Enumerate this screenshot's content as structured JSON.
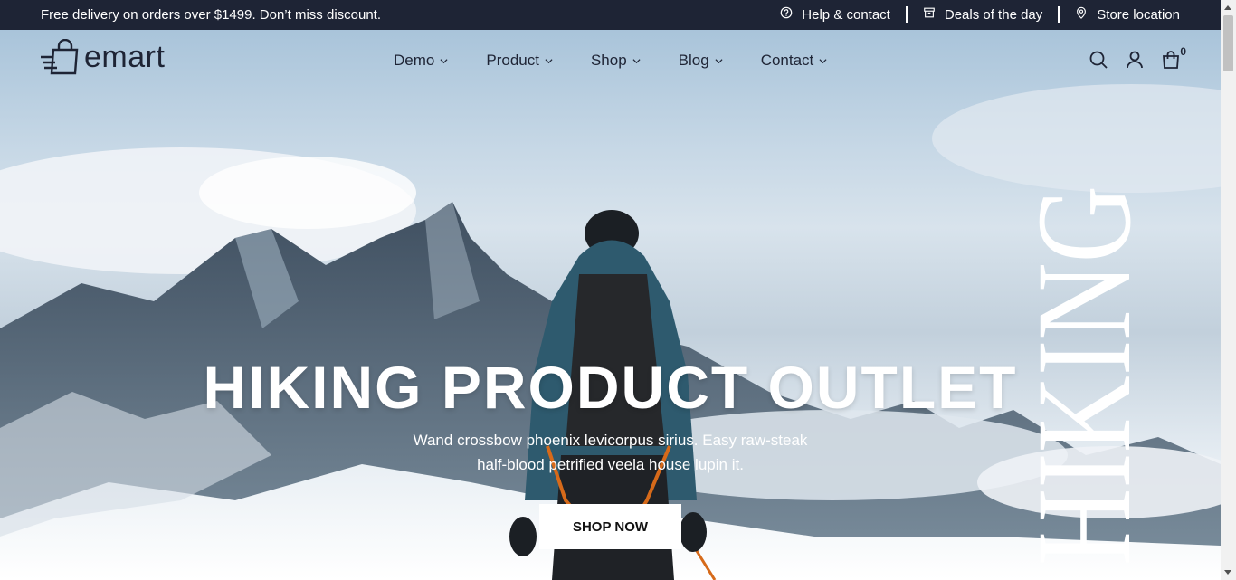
{
  "topbar": {
    "promo": "Free delivery on orders over $1499. Don’t miss discount.",
    "links": [
      {
        "label": "Help & contact",
        "icon": "help-circle-icon"
      },
      {
        "label": "Deals of the day",
        "icon": "archive-icon"
      },
      {
        "label": "Store location",
        "icon": "map-pin-icon"
      }
    ]
  },
  "header": {
    "logo": "emart",
    "nav": [
      {
        "label": "Demo"
      },
      {
        "label": "Product"
      },
      {
        "label": "Shop"
      },
      {
        "label": "Blog"
      },
      {
        "label": "Contact"
      }
    ],
    "cart_count": "0"
  },
  "hero": {
    "title": "HIKING PRODUCT OUTLET",
    "subtitle": "Wand crossbow phoenix levicorpus sirius. Easy raw-steak half-blood petrified veela house lupin it.",
    "button": "SHOP NOW",
    "vertical_text": "HIKING"
  },
  "colors": {
    "dark": "#1e2435",
    "white": "#ffffff"
  }
}
